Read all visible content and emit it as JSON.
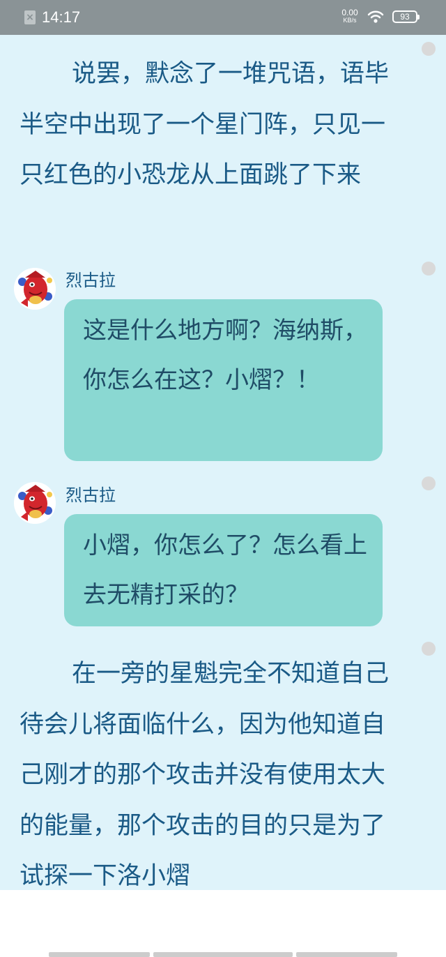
{
  "status_bar": {
    "time": "14:17",
    "net_speed": "0.00",
    "net_unit": "KB/s",
    "battery": "93",
    "notification_icon": "close-x-icon",
    "wifi_icon": "wifi-icon",
    "battery_icon": "battery-icon"
  },
  "story": {
    "narration_1": "说罢，默念了一堆咒语，语毕半空中出现了一个星门阵，只见一只红色的小恐龙从上面跳了下来",
    "dialogues": [
      {
        "speaker": "烈古拉",
        "text": "这是什么地方啊？海纳斯，你怎么在这？小熠？！",
        "avatar": "red-dinosaur-avatar"
      },
      {
        "speaker": "烈古拉",
        "text": "小熠，你怎么了？怎么看上去无精打采的？",
        "avatar": "red-dinosaur-avatar"
      }
    ],
    "narration_2": "在一旁的星魁完全不知道自己待会儿将面临什么，因为他知道自己刚才的那个攻击并没有使用太大的能量，那个攻击的目的只是为了试探一下洛小熠"
  },
  "colors": {
    "reader_background": "#dff3fa",
    "text": "#1a5a86",
    "bubble": "#8ad8d2",
    "status_bar": "#8a9396"
  }
}
